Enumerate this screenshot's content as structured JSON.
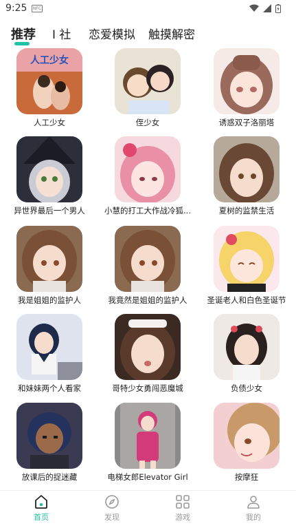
{
  "status": {
    "time": "9:25",
    "nfc_icon": "nfc-icon"
  },
  "tabs": [
    {
      "label": "推荐",
      "active": true
    },
    {
      "label": "I 社",
      "active": false
    },
    {
      "label": "恋爱模拟",
      "active": false
    },
    {
      "label": "触摸解密",
      "active": false
    }
  ],
  "colors": {
    "accent": "#1ec2a6",
    "inactive": "#999999"
  },
  "games": [
    {
      "title": "人工少女"
    },
    {
      "title": "侄少女"
    },
    {
      "title": "诱惑双子洛丽塔"
    },
    {
      "title": "异世界最后一个男人"
    },
    {
      "title": "小慧的打工大作战冷狐..."
    },
    {
      "title": "夏树的监禁生活"
    },
    {
      "title": "我是姐姐的监护人"
    },
    {
      "title": "我竟然是姐姐的监护人"
    },
    {
      "title": "圣诞老人和白色圣诞节"
    },
    {
      "title": "和妹妹两个人看家"
    },
    {
      "title": "哥特少女勇闯恶魔城"
    },
    {
      "title": "负债少女"
    },
    {
      "title": "放课后的捉迷藏"
    },
    {
      "title": "电梯女郎Elevator Girl"
    },
    {
      "title": "按摩狂"
    }
  ],
  "nav": [
    {
      "label": "首页",
      "icon": "home-icon",
      "active": true
    },
    {
      "label": "发现",
      "icon": "compass-icon",
      "active": false
    },
    {
      "label": "游戏",
      "icon": "grid-icon",
      "active": false
    },
    {
      "label": "我的",
      "icon": "user-icon",
      "active": false
    }
  ]
}
